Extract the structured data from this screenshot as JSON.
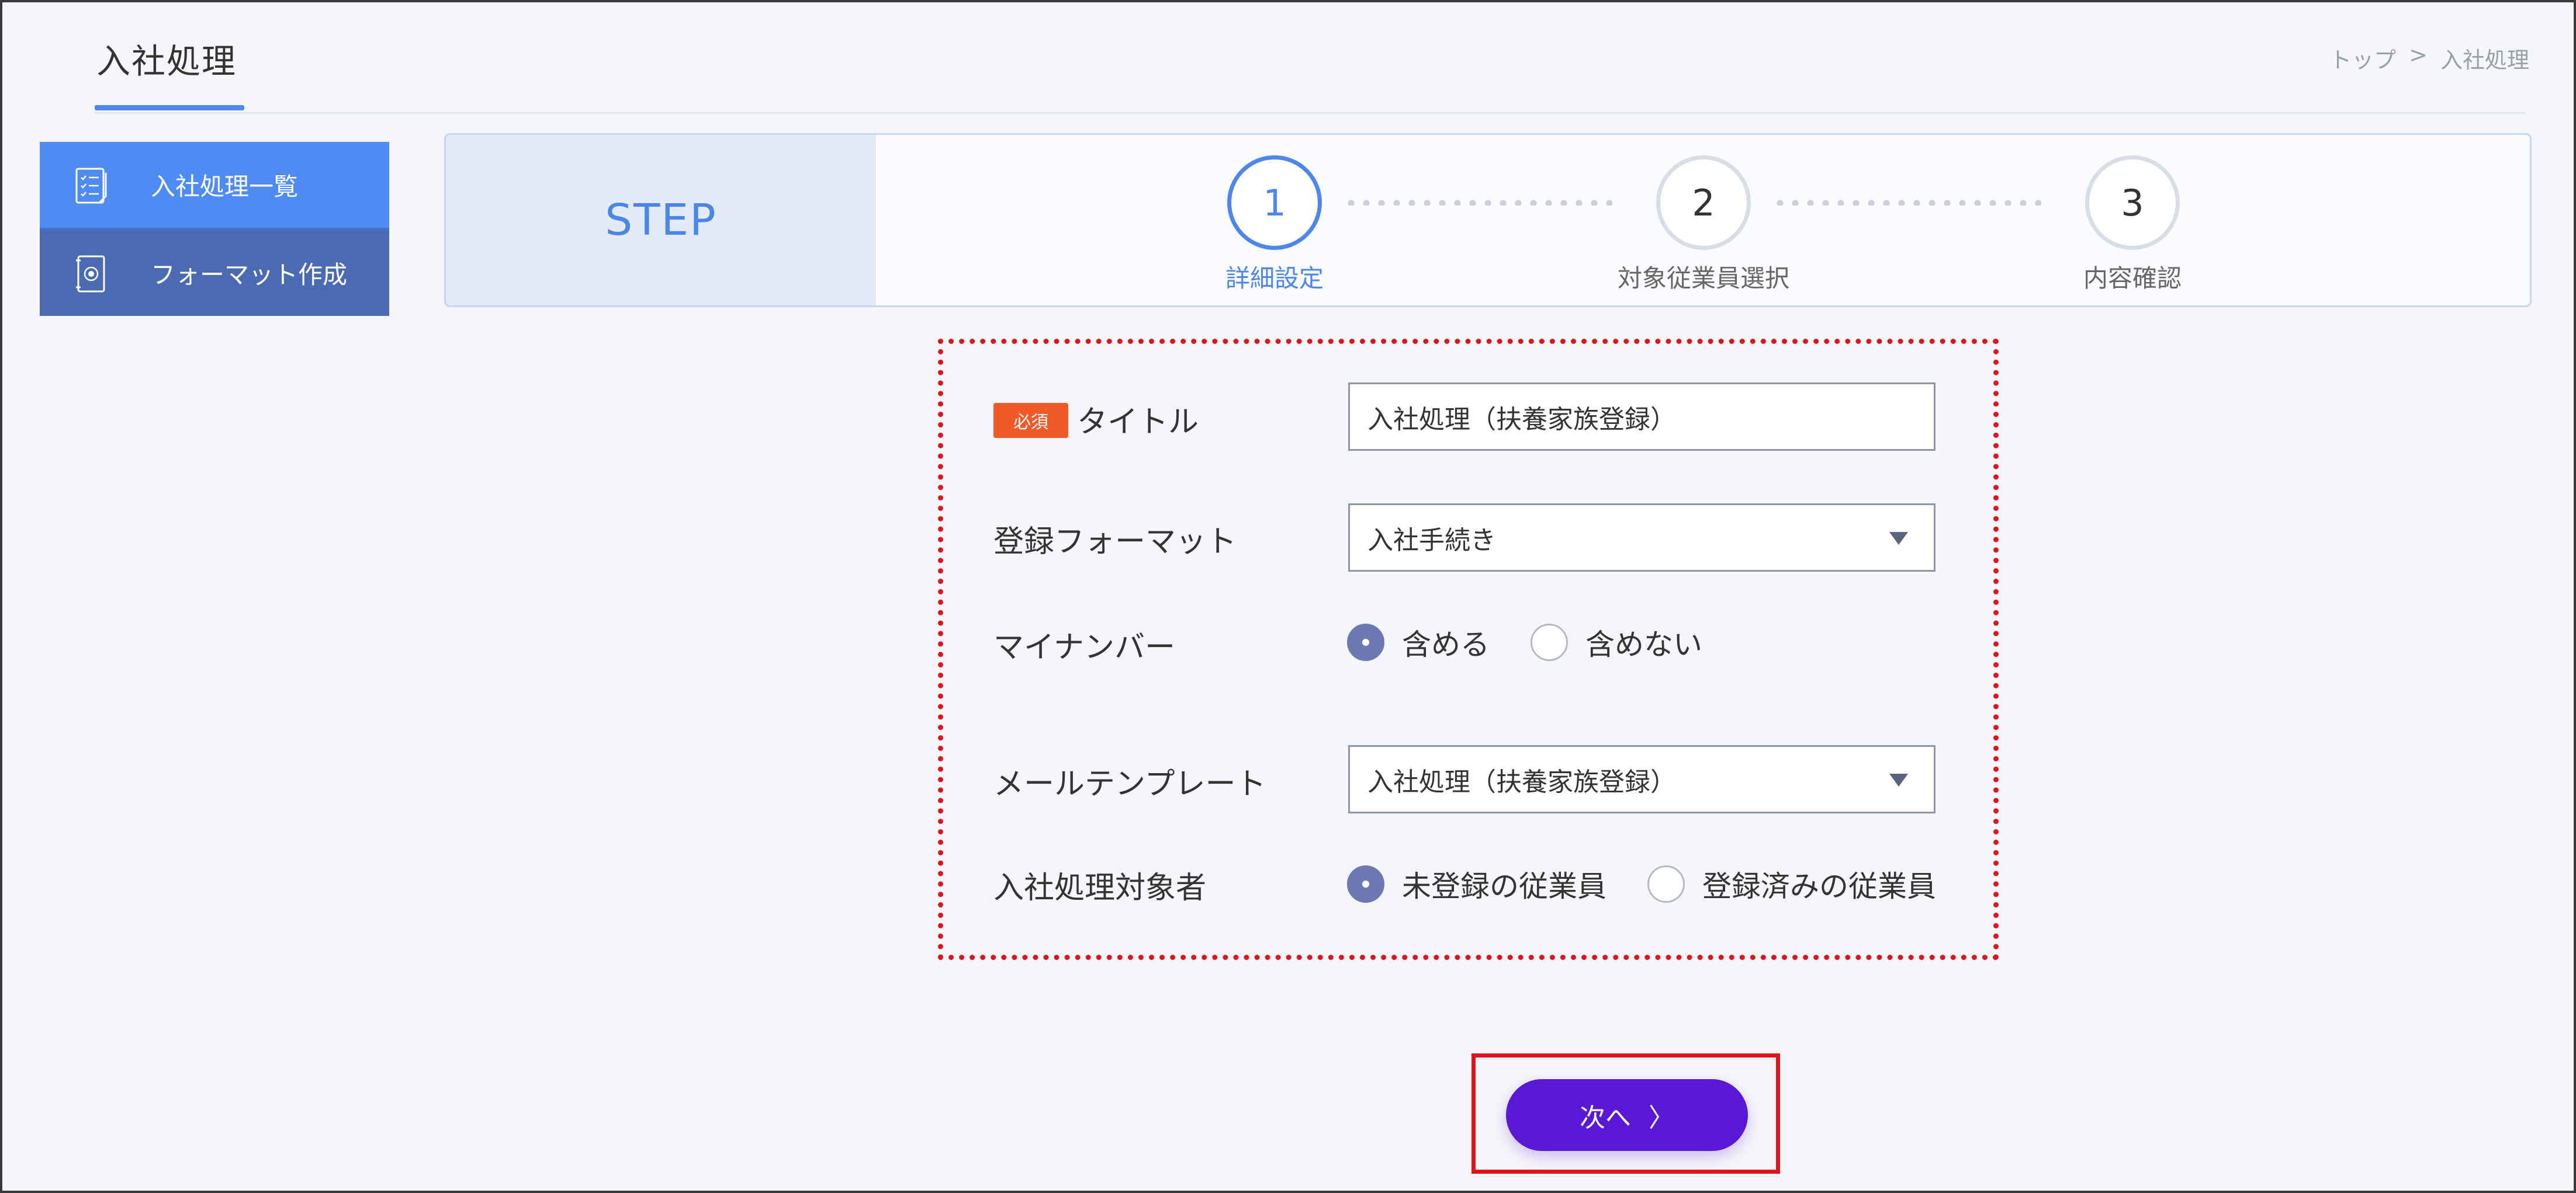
{
  "header": {
    "title": "入社処理",
    "breadcrumb": [
      "トップ",
      ">",
      "入社処理"
    ]
  },
  "sidebar": {
    "items": [
      {
        "label": "入社処理一覧",
        "icon": "checklist-icon",
        "active": true
      },
      {
        "label": "フォーマット作成",
        "icon": "document-seal-icon",
        "active": false
      }
    ]
  },
  "steps": {
    "heading": "STEP",
    "items": [
      {
        "number": "1",
        "label": "詳細設定",
        "active": true
      },
      {
        "number": "2",
        "label": "対象従業員選択",
        "active": false
      },
      {
        "number": "3",
        "label": "内容確認",
        "active": false
      }
    ]
  },
  "form": {
    "required_badge": "必須",
    "title_label": "タイトル",
    "title_value": "入社処理（扶養家族登録）",
    "format_label": "登録フォーマット",
    "format_value": "入社手続き",
    "mynumber_label": "マイナンバー",
    "mynumber_options": [
      "含める",
      "含めない"
    ],
    "mynumber_selected": "含める",
    "mail_label": "メールテンプレート",
    "mail_value": "入社処理（扶養家族登録）",
    "target_label": "入社処理対象者",
    "target_options": [
      "未登録の従業員",
      "登録済みの従業員"
    ],
    "target_selected": "未登録の従業員"
  },
  "actions": {
    "next_label": "次へ",
    "next_icon": "〉"
  },
  "colors": {
    "accent": "#4e86f0",
    "sidebar_active": "#4e8cf3",
    "sidebar_normal": "#4a6bb3",
    "required": "#f05a28",
    "next_button": "#5b17d6",
    "highlight": "#e0141c"
  }
}
